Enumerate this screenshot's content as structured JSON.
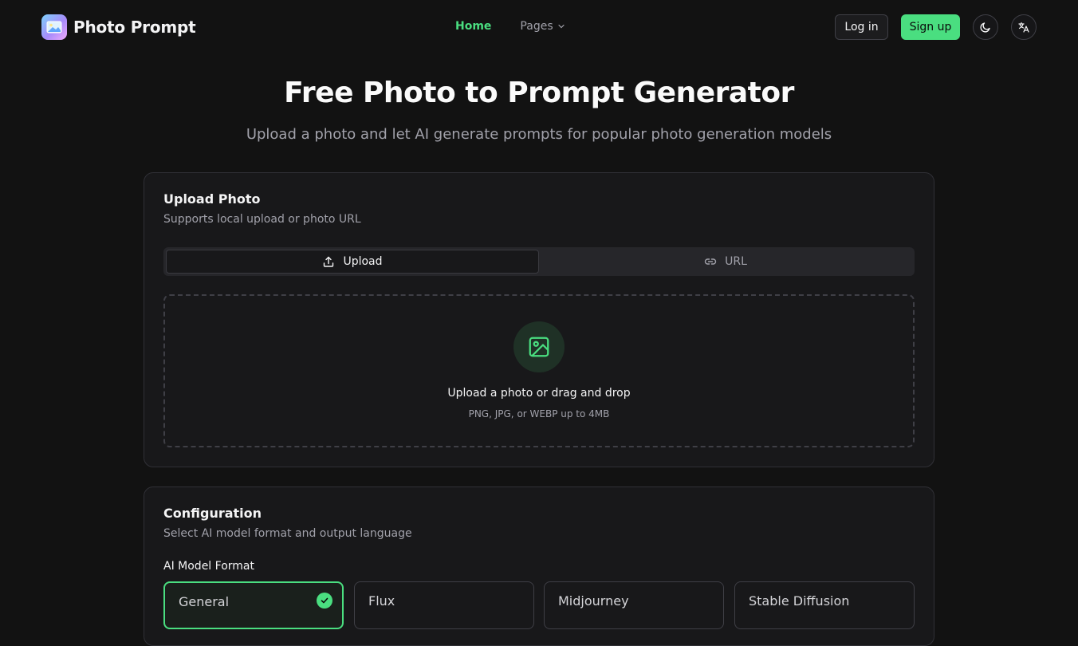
{
  "header": {
    "brand": "Photo Prompt",
    "nav": {
      "home": "Home",
      "pages": "Pages"
    },
    "login": "Log in",
    "signup": "Sign up",
    "icons": {
      "theme": "moon-icon",
      "language": "translate-icon"
    }
  },
  "hero": {
    "title": "Free Photo to Prompt Generator",
    "subtitle": "Upload a photo and let AI generate prompts for popular photo generation models"
  },
  "upload_card": {
    "title": "Upload Photo",
    "description": "Supports local upload or photo URL",
    "tabs": [
      {
        "label": "Upload",
        "icon": "upload-icon",
        "active": true
      },
      {
        "label": "URL",
        "icon": "link-icon",
        "active": false
      }
    ],
    "dropzone": {
      "title": "Upload a photo or drag and drop",
      "hint": "PNG, JPG, or WEBP up to 4MB",
      "icon": "image-icon"
    }
  },
  "config_card": {
    "title": "Configuration",
    "description": "Select AI model format and output language",
    "model_label": "AI Model Format",
    "models": [
      {
        "name": "General",
        "selected": true
      },
      {
        "name": "Flux",
        "selected": false
      },
      {
        "name": "Midjourney",
        "selected": false
      },
      {
        "name": "Stable Diffusion",
        "selected": false
      }
    ]
  },
  "colors": {
    "accent": "#4ade80",
    "background": "#121212",
    "card": "#18181a",
    "muted_text": "#a1a1aa"
  }
}
